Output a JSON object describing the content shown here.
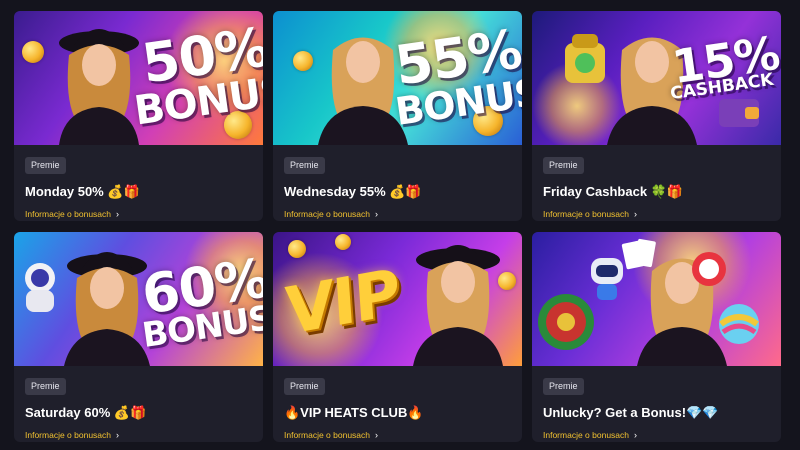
{
  "colors": {
    "page_background": "#14141d",
    "card_background": "#1f1f2b",
    "badge_background": "#3a3a48",
    "link_color": "#f2c230"
  },
  "cards": [
    {
      "banner": {
        "line1": "50%",
        "line2": "BONUS",
        "theme": "purple-orange"
      },
      "badge": "Premie",
      "title": "Monday 50% 💰🎁",
      "link": "Informacje o bonusach"
    },
    {
      "banner": {
        "line1": "55%",
        "line2": "BONUS",
        "theme": "cyan"
      },
      "badge": "Premie",
      "title": "Wednesday 55% 💰🎁",
      "link": "Informacje o bonusach"
    },
    {
      "banner": {
        "line1": "15%",
        "line2": "CASHBACK",
        "theme": "violet"
      },
      "badge": "Premie",
      "title": "Friday Cashback 🍀🎁",
      "link": "Informacje o bonusach"
    },
    {
      "banner": {
        "line1": "60%",
        "line2": "BONUS",
        "theme": "blue-pink"
      },
      "badge": "Premie",
      "title": "Saturday 60% 💰🎁",
      "link": "Informacje o bonusach"
    },
    {
      "banner": {
        "line1": "VIP",
        "theme": "gold-purple"
      },
      "badge": "Premie",
      "title": "🔥VIP HEATS CLUB🔥",
      "link": "Informacje o bonusach"
    },
    {
      "banner": {
        "theme": "purple-roulette"
      },
      "badge": "Premie",
      "title": "Unlucky? Get a Bonus!💎💎",
      "link": "Informacje o bonusach"
    }
  ],
  "icons": {
    "link_arrow": "chevron-right-icon"
  }
}
